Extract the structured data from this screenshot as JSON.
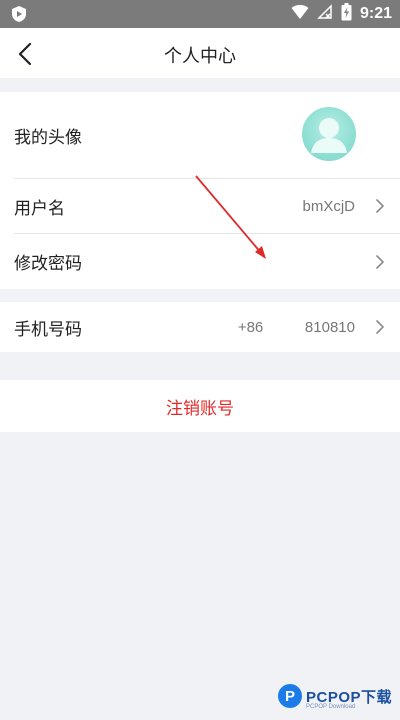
{
  "status_bar": {
    "time": "9:21"
  },
  "header": {
    "title": "个人中心"
  },
  "profile": {
    "avatar_label": "我的头像",
    "username_label": "用户名",
    "username_value": "bmXcjD",
    "password_label": "修改密码"
  },
  "phone": {
    "label": "手机号码",
    "value": "+86          810810"
  },
  "logout": {
    "label": "注销账号"
  },
  "watermark": {
    "text": "PCPOP下载",
    "sub": "PCPOP Download"
  },
  "colors": {
    "accent_red": "#e02a2a",
    "annotation_arrow": "#e02a2a",
    "avatar": "#8fdfd3"
  }
}
